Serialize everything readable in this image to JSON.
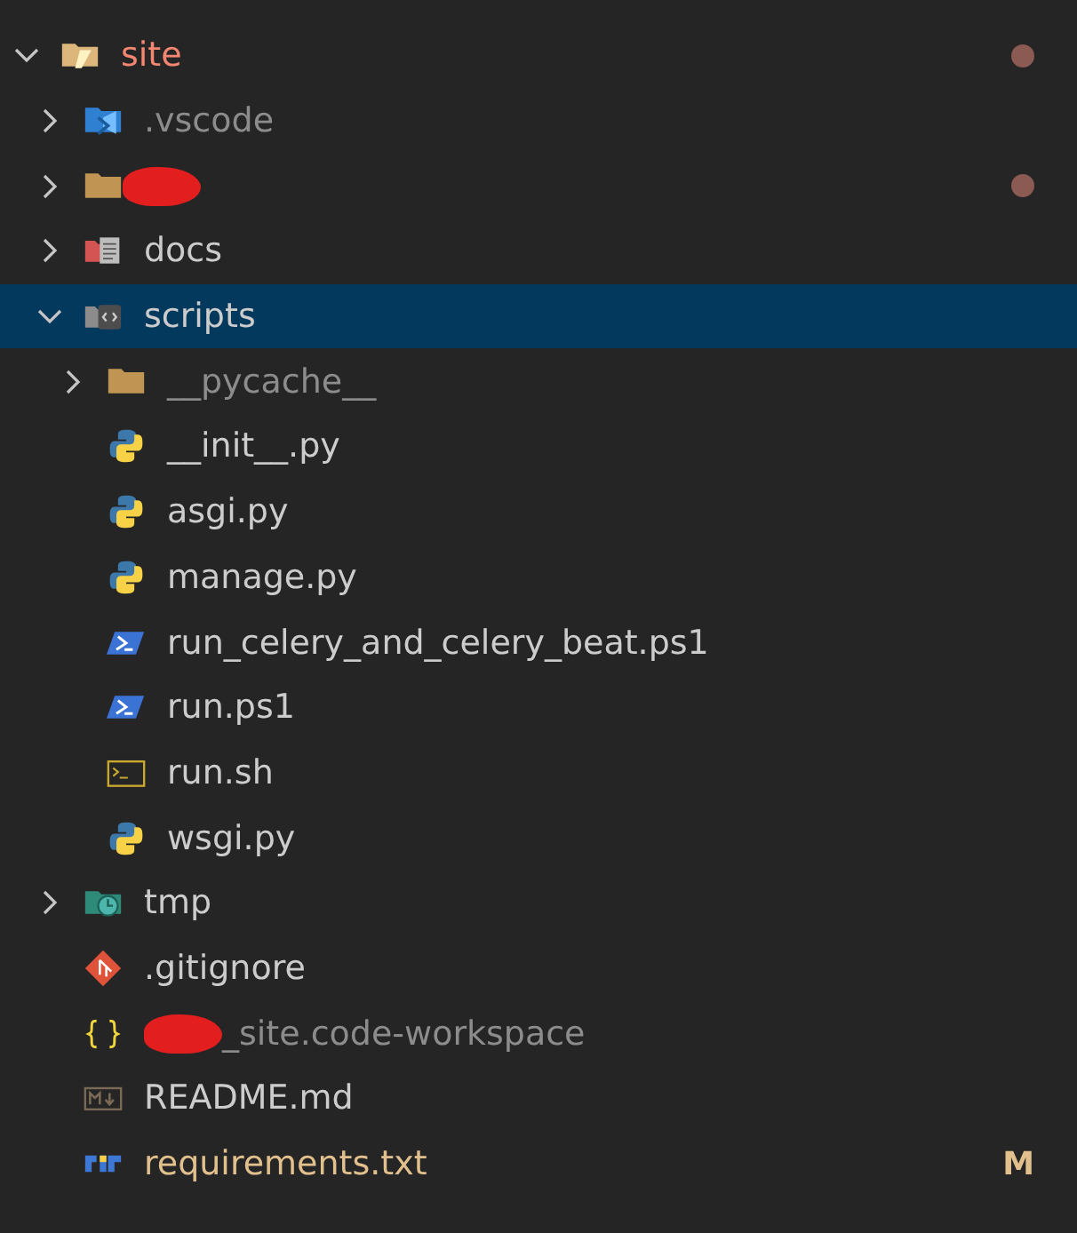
{
  "explorer": {
    "tree": [
      {
        "name": "site",
        "kind": "root-folder",
        "expanded": true,
        "selected": false,
        "color": "#f48771",
        "dot": true,
        "children": [
          {
            "name": ".vscode",
            "kind": "vscode-folder",
            "expanded": false,
            "selected": false,
            "color": "#8c8c8c",
            "dot": false
          },
          {
            "kind": "folder",
            "expanded": false,
            "selected": false,
            "dot": true,
            "redacted": true
          },
          {
            "name": "docs",
            "kind": "docs-folder",
            "expanded": false,
            "selected": false,
            "dot": false
          },
          {
            "name": "scripts",
            "kind": "code-folder",
            "expanded": true,
            "selected": true,
            "dot": false,
            "children": [
              {
                "name": "__pycache__",
                "kind": "folder",
                "expanded": false,
                "selected": false,
                "color": "#8c8c8c",
                "dot": false
              },
              {
                "name": "__init__.py",
                "kind": "python",
                "selected": false,
                "dot": false
              },
              {
                "name": "asgi.py",
                "kind": "python",
                "selected": false,
                "dot": false
              },
              {
                "name": "manage.py",
                "kind": "python",
                "selected": false,
                "dot": false
              },
              {
                "name": "run_celery_and_celery_beat.ps1",
                "kind": "powershell",
                "selected": false,
                "dot": false
              },
              {
                "name": "run.ps1",
                "kind": "powershell",
                "selected": false,
                "dot": false
              },
              {
                "name": "run.sh",
                "kind": "shell",
                "selected": false,
                "dot": false
              },
              {
                "name": "wsgi.py",
                "kind": "python",
                "selected": false,
                "dot": false
              }
            ]
          },
          {
            "name": "tmp",
            "kind": "clock-folder",
            "expanded": false,
            "selected": false,
            "dot": false
          },
          {
            "name": ".gitignore",
            "kind": "git",
            "selected": false,
            "dot": false
          },
          {
            "name": "_site.code-workspace",
            "kind": "json",
            "selected": false,
            "color": "#8c8c8c",
            "dot": false,
            "redacted": true
          },
          {
            "name": "README.md",
            "kind": "markdown",
            "selected": false,
            "dot": false
          },
          {
            "name": "requirements.txt",
            "kind": "pip",
            "selected": false,
            "color": "#e2c08d",
            "dot": false,
            "badge": "M"
          }
        ]
      }
    ]
  }
}
